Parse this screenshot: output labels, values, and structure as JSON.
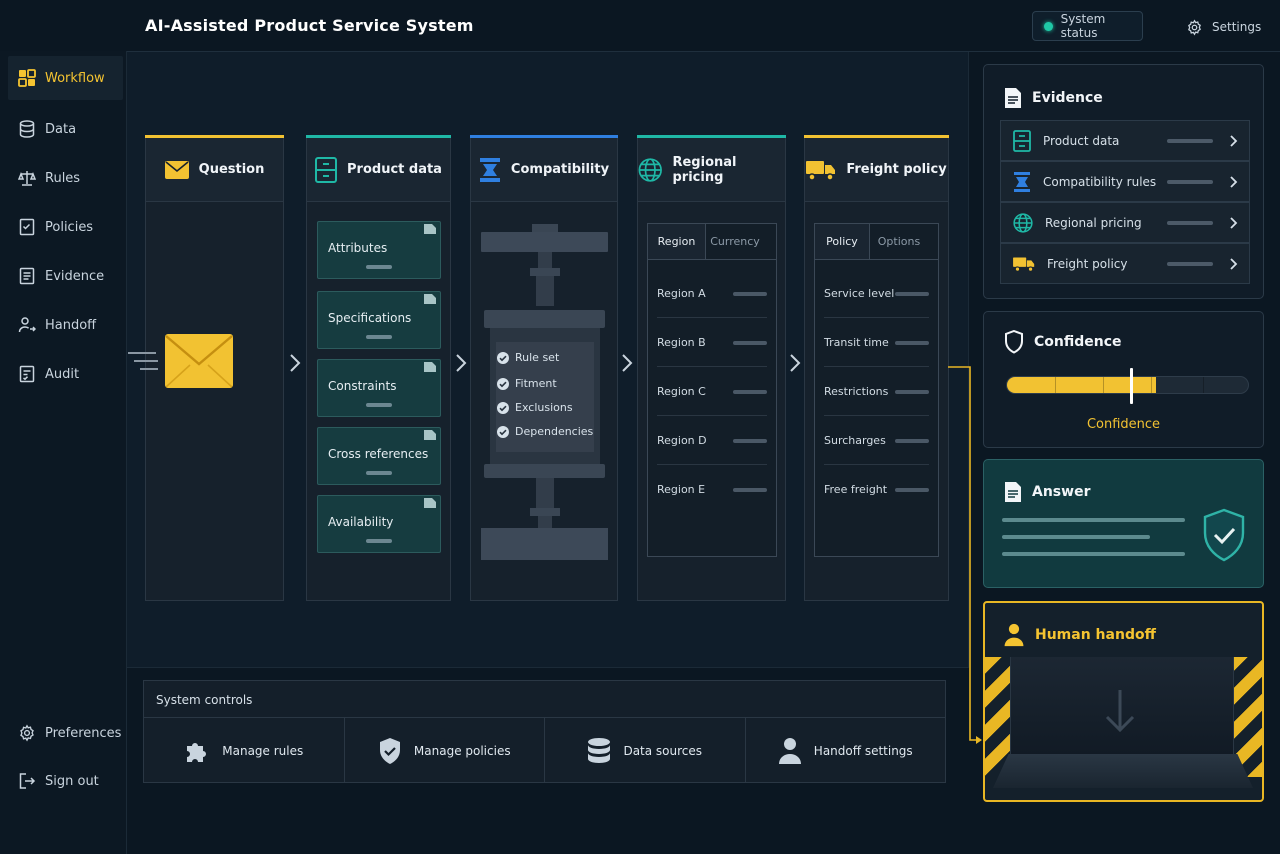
{
  "header": {
    "title": "AI-Assisted Product Service System",
    "status_label": "System status",
    "settings_label": "Settings"
  },
  "sidebar": {
    "items": [
      {
        "label": "Workflow",
        "icon": "grid-icon",
        "active": true
      },
      {
        "label": "Data",
        "icon": "database-icon"
      },
      {
        "label": "Rules",
        "icon": "scales-icon"
      },
      {
        "label": "Policies",
        "icon": "checklist-icon"
      },
      {
        "label": "Evidence",
        "icon": "document-icon"
      },
      {
        "label": "Handoff",
        "icon": "person-arrow-icon"
      },
      {
        "label": "Audit",
        "icon": "audit-icon"
      }
    ],
    "bottom": [
      {
        "label": "Preferences",
        "icon": "gear-icon"
      },
      {
        "label": "Sign out",
        "icon": "sign-out-icon"
      }
    ]
  },
  "workflow": {
    "columns": [
      {
        "title": "Question",
        "icon": "envelope-icon",
        "accent": "#f2c232"
      },
      {
        "title": "Product data",
        "icon": "file-cabinet-icon",
        "accent": "#1fb8a6"
      },
      {
        "title": "Compatibility",
        "icon": "filter-press-icon",
        "accent": "#2f7fe0"
      },
      {
        "title": "Regional pricing",
        "icon": "globe-icon",
        "accent": "#1fb8a6"
      },
      {
        "title": "Freight policy",
        "icon": "truck-icon",
        "accent": "#f2c232"
      }
    ],
    "product_cards": [
      "Attributes",
      "Specifications",
      "Constraints",
      "Cross references",
      "Availability"
    ],
    "compatibility_checks": [
      "Rule set",
      "Fitment",
      "Exclusions",
      "Dependencies"
    ],
    "pricing": {
      "tabs": [
        "Region",
        "Currency"
      ],
      "rows": [
        "Region A",
        "Region B",
        "Region C",
        "Region D",
        "Region E"
      ]
    },
    "freight": {
      "tabs": [
        "Policy",
        "Options"
      ],
      "rows": [
        "Service level",
        "Transit time",
        "Restrictions",
        "Surcharges",
        "Free freight"
      ]
    }
  },
  "controls": {
    "title": "System controls",
    "items": [
      {
        "label": "Manage rules",
        "icon": "puzzle-icon"
      },
      {
        "label": "Manage policies",
        "icon": "shield-check-icon"
      },
      {
        "label": "Data sources",
        "icon": "database-icon"
      },
      {
        "label": "Handoff settings",
        "icon": "person-icon"
      }
    ]
  },
  "evidence": {
    "title": "Evidence",
    "items": [
      {
        "label": "Product data",
        "icon": "file-cabinet-icon"
      },
      {
        "label": "Compatibility rules",
        "icon": "filter-press-icon"
      },
      {
        "label": "Regional pricing",
        "icon": "globe-icon"
      },
      {
        "label": "Freight policy",
        "icon": "truck-icon"
      }
    ]
  },
  "confidence": {
    "title": "Confidence",
    "label": "Confidence",
    "level": 0.62
  },
  "answer": {
    "title": "Answer"
  },
  "handoff": {
    "title": "Human handoff"
  },
  "colors": {
    "yellow": "#f2c232",
    "teal": "#1fb8a6",
    "blue": "#2f7fe0",
    "status_ok": "#1fc8a6"
  }
}
